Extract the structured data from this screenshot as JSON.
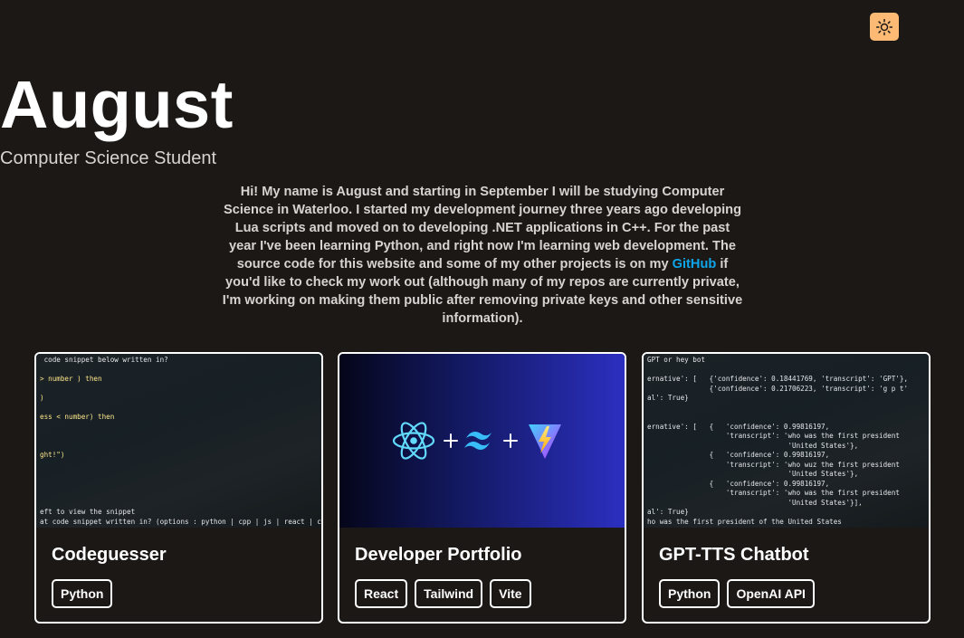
{
  "theme_toggle": {
    "icon": "sun-icon",
    "color": "#fdba74"
  },
  "hero": {
    "name": "August",
    "subtitle": "Computer Science Student",
    "bio_before": "Hi! My name is August and starting in September I will be studying Computer Science in Waterloo. I started my development journey three years ago developing Lua scripts and moved on to developing .NET applications in C++. For the past year I've been learning Python, and right now I'm learning web development. The source code for this website and some of my other projects is on my ",
    "bio_link": "GitHub",
    "bio_after": " if you'd like to check my work out (although many of my repos are currently private, I'm working on making them public after removing private keys and other sensitive information)."
  },
  "projects": [
    {
      "title": "Codeguesser",
      "tags": [
        "Python"
      ],
      "terminal": [
        " code snippet below written in?",
        "",
        "> number ) then",
        "",
        ")",
        "",
        "ess < number) then",
        "",
        "",
        "",
        "ght!\")",
        "",
        "",
        "",
        "",
        "",
        "eft to view the snippet",
        "at code snippet written in? (options : python | cpp | js | react | css | rust |"
      ]
    },
    {
      "title": "Developer Portfolio",
      "tags": [
        "React",
        "Tailwind",
        "Vite"
      ]
    },
    {
      "title": "GPT-TTS Chatbot",
      "tags": [
        "Python",
        "OpenAI API"
      ],
      "terminal": [
        "GPT or hey bot",
        "",
        "ernative': [   {'confidence': 0.18441769, 'transcript': 'GPT'},",
        "               {'confidence': 0.21706223, 'transcript': 'g p t'",
        "al': True}",
        "",
        "",
        "ernative': [   {   'confidence': 0.99816197,",
        "                   'transcript': 'who was the first president",
        "                                  'United States'},",
        "               {   'confidence': 0.99816197,",
        "                   'transcript': 'who wuz the first president",
        "                                  'United States'},",
        "               {   'confidence': 0.99816197,",
        "                   'transcript': 'who was the first president",
        "                                  'United States'}],",
        "al': True}",
        "ho was the first president of the United States"
      ]
    }
  ]
}
